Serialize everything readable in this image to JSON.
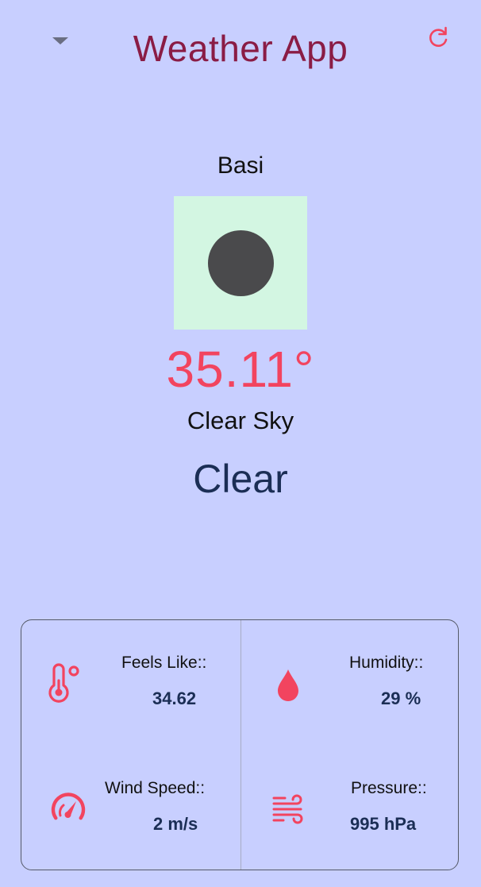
{
  "header": {
    "title": "Weather App",
    "dropdown_icon": "caret-down-icon",
    "refresh_icon": "refresh-icon"
  },
  "weather": {
    "city": "Basi",
    "temperature": "35.11°",
    "description": "Clear Sky",
    "main": "Clear"
  },
  "stats": {
    "feels_like": {
      "label": "Feels Like::",
      "value": "34.62",
      "icon": "thermometer-icon"
    },
    "humidity": {
      "label": "Humidity::",
      "value": "29 %",
      "icon": "water-drop-icon"
    },
    "wind_speed": {
      "label": "Wind Speed::",
      "value": "2 m/s",
      "icon": "speedometer-icon"
    },
    "pressure": {
      "label": "Pressure::",
      "value": "995 hPa",
      "icon": "wind-icon"
    }
  },
  "colors": {
    "background": "#c8cfff",
    "title": "#8a1c45",
    "accent": "#f2445f",
    "value_text": "#1b2e55",
    "icon_box": "#d3f6e2",
    "icon_dot": "#4a4a4c"
  }
}
